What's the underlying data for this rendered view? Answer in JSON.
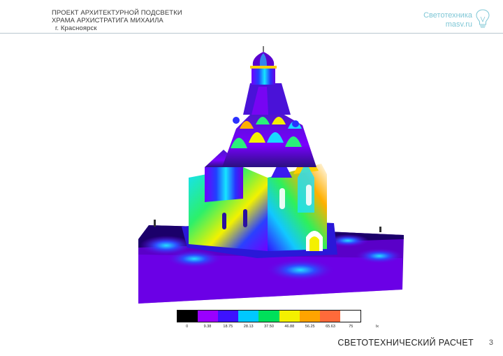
{
  "header": {
    "line1": "ПРОЕКТ АРХИТЕКТУРНОЙ ПОДСВЕТКИ",
    "line2": "ХРАМА АРХИСТРАТИГА МИХАИЛА",
    "line3": "г. Красноярск"
  },
  "brand": {
    "name": "Светотехника",
    "site": "masv.ru",
    "icon": "lightbulb-icon"
  },
  "render": {
    "icon": "church-illuminance-render"
  },
  "legend": {
    "unit": "lx",
    "labels": [
      "0",
      "9.38",
      "18.75",
      "28.13",
      "37.50",
      "46.88",
      "56.25",
      "65.63",
      "75"
    ],
    "colors": [
      "#000000",
      "#9a00ff",
      "#3d12ff",
      "#00c8ff",
      "#00e05a",
      "#f4f000",
      "#ffa400",
      "#ff6a3a",
      "#ffffff"
    ]
  },
  "footer": {
    "title": "СВЕТОТЕХНИЧЕСКИЙ РАСЧЕТ",
    "page": "3"
  }
}
